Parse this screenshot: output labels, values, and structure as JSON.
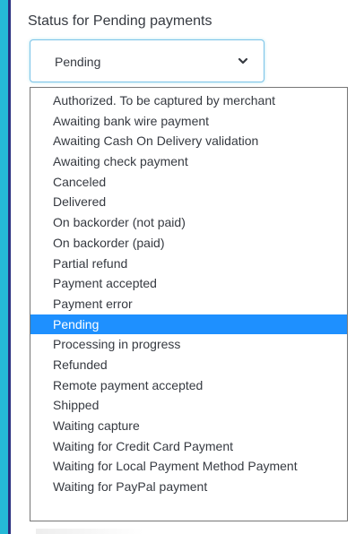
{
  "field": {
    "label": "Status for Pending payments",
    "selected_value": "Pending"
  },
  "dropdown": {
    "selected_index": 11,
    "options": [
      {
        "label": "Authorized. To be captured by merchant"
      },
      {
        "label": "Awaiting bank wire payment"
      },
      {
        "label": "Awaiting Cash On Delivery validation"
      },
      {
        "label": "Awaiting check payment"
      },
      {
        "label": "Canceled"
      },
      {
        "label": "Delivered"
      },
      {
        "label": "On backorder (not paid)"
      },
      {
        "label": "On backorder (paid)"
      },
      {
        "label": "Partial refund"
      },
      {
        "label": "Payment accepted"
      },
      {
        "label": "Payment error"
      },
      {
        "label": "Pending"
      },
      {
        "label": "Processing in progress"
      },
      {
        "label": "Refunded"
      },
      {
        "label": "Remote payment accepted"
      },
      {
        "label": "Shipped"
      },
      {
        "label": "Waiting capture"
      },
      {
        "label": "Waiting for Credit Card Payment"
      },
      {
        "label": "Waiting for Local Payment Method Payment"
      },
      {
        "label": "Waiting for PayPal payment"
      }
    ]
  },
  "colors": {
    "accent": "#25b9d7",
    "sidebar_dark": "#2a2f7f",
    "selected_bg": "#1e90ff",
    "text": "#363a41",
    "focus_border": "#7cc3e8"
  },
  "icons": {
    "select_chevron": "chevron-down-icon"
  }
}
